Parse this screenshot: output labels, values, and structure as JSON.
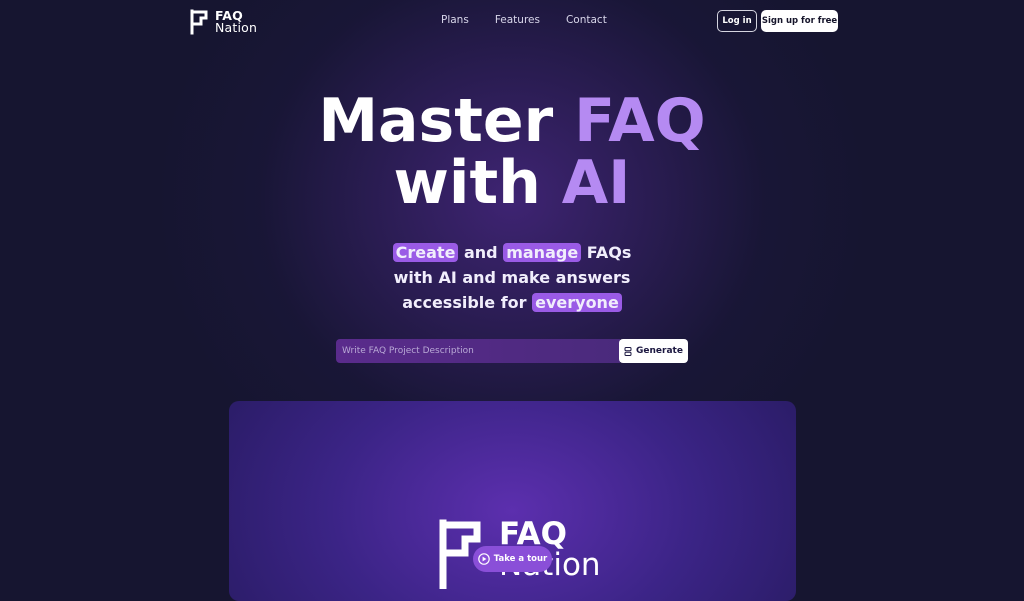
{
  "nav": {
    "logo_line1": "FAQ",
    "logo_line2": "Nation",
    "links": [
      "Plans",
      "Features",
      "Contact"
    ],
    "login_label": "Log in",
    "signup_label": "Sign up for free"
  },
  "hero": {
    "title_part1": "Master ",
    "title_accent1": "FAQ",
    "title_part2": "with ",
    "title_accent2": "AI",
    "sub_hl1": "Create",
    "sub_text1": " and ",
    "sub_hl2": "manage",
    "sub_text2": " FAQs",
    "sub_line2": "with AI and make answers",
    "sub_text3": "accessible for ",
    "sub_hl3": "everyone"
  },
  "search": {
    "placeholder": "Write FAQ Project Description",
    "value": "",
    "button_label": "Generate"
  },
  "preview": {
    "logo_line1": "FAQ",
    "logo_line2": "Nation",
    "tour_label": "Take a tour"
  },
  "colors": {
    "background": "#161530",
    "accent": "#b58af2",
    "highlight": "#9a5be6"
  },
  "icons": [
    "flag-logo-icon",
    "hourglass-icon",
    "play-circle-icon"
  ]
}
